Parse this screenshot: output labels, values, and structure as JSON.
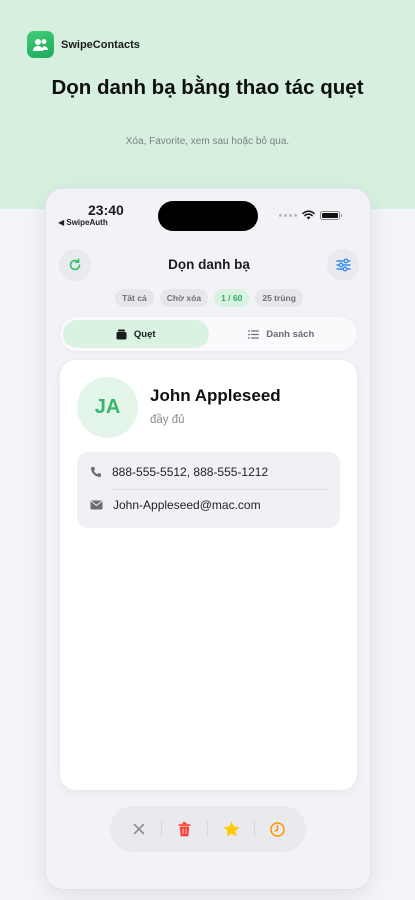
{
  "app": {
    "name": "SwipeContacts",
    "logo_icon": "contacts-app-icon"
  },
  "hero": {
    "title": "Dọn danh bạ bằng thao tác quẹt",
    "subtitle": "Xóa, Favorite, xem sau hoặc bỏ qua."
  },
  "status_bar": {
    "time": "23:40",
    "back_label": "◀ SwipeAuth"
  },
  "nav": {
    "title": "Dọn danh bạ",
    "left_icon": "refresh-icon",
    "right_icon": "sliders-icon"
  },
  "filters": [
    {
      "label": "Tất cả",
      "active": false
    },
    {
      "label": "Chờ xóa",
      "active": false
    },
    {
      "label": "1 / 60",
      "active": true
    },
    {
      "label": "25 trùng",
      "active": false
    }
  ],
  "segments": [
    {
      "label": "Quẹt",
      "icon": "cards-icon",
      "active": true
    },
    {
      "label": "Danh sách",
      "icon": "list-icon",
      "active": false
    }
  ],
  "contact": {
    "initials": "JA",
    "name": "John Appleseed",
    "status": "đầy đủ",
    "phone": "888-555-5512, 888-555-1212",
    "email": "John-Appleseed@mac.com"
  },
  "actions": [
    {
      "name": "skip",
      "icon": "close-icon",
      "color": "#8e8e93"
    },
    {
      "name": "delete",
      "icon": "trash-icon",
      "color": "#ff3b30"
    },
    {
      "name": "favorite",
      "icon": "star-icon",
      "color": "#ffcc00"
    },
    {
      "name": "later",
      "icon": "clock-icon",
      "color": "#ff9500"
    }
  ],
  "colors": {
    "accent": "#34c36a",
    "accent_soft": "#d9f2e1",
    "hero_bg": "#d6efdf",
    "blue": "#2f8cf0"
  }
}
